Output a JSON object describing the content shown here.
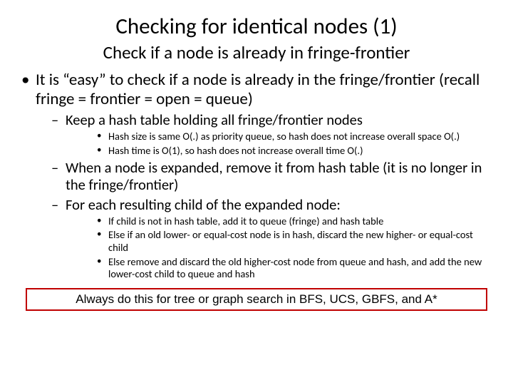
{
  "title": "Checking for identical nodes (1)",
  "subtitle": "Check if a node is already in fringe-frontier",
  "b1": "It is “easy” to check if a node is already in the fringe/frontier (recall fringe = frontier = open = queue)",
  "b1a": "Keep a hash table holding all fringe/frontier nodes",
  "b1a1": "Hash size is same O(.) as priority queue, so hash does not increase overall space O(.)",
  "b1a2": "Hash time is O(1), so hash does not increase overall time O(.)",
  "b1b": "When a node is expanded, remove it from hash table (it is no longer in the fringe/frontier)",
  "b1c": "For each resulting child of the expanded node:",
  "b1c1": "If child is not in hash table, add it to queue (fringe) and hash table",
  "b1c2": "Else if an old lower- or equal-cost node is in hash, discard the new higher- or equal-cost child",
  "b1c3": "Else remove and discard the old higher-cost node from queue and hash, and add the new lower-cost child to queue and hash",
  "callout": "Always do this for tree or graph search in BFS, UCS, GBFS, and A*"
}
